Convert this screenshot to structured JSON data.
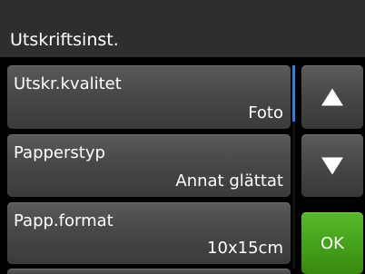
{
  "header": {
    "title": "Utskriftsinst."
  },
  "menu": {
    "items": [
      {
        "label": "Utskr.kvalitet",
        "value": "Foto"
      },
      {
        "label": "Papperstyp",
        "value": "Annat glättat"
      },
      {
        "label": "Papp.format",
        "value": "10x15cm"
      }
    ]
  },
  "buttons": {
    "up_icon": "triangle-up",
    "down_icon": "triangle-down",
    "ok_label": "OK"
  },
  "colors": {
    "header_bg": "#2e2e2e",
    "item_bg": "#484848",
    "scroll_accent": "#2f7fd8",
    "ok_green": "#45a01a",
    "text": "#ffffff"
  }
}
